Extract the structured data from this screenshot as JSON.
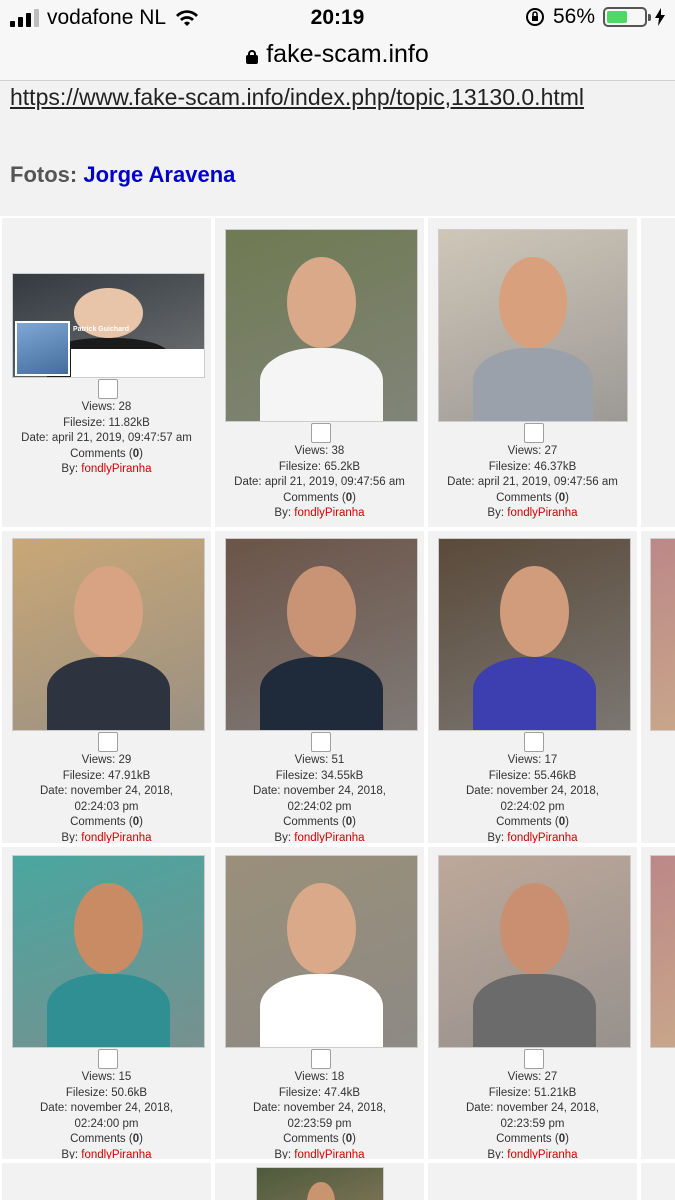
{
  "status_bar": {
    "carrier": "vodafone NL",
    "time": "20:19",
    "battery": "56%",
    "battery_level": 0.56
  },
  "url_bar": {
    "domain": "fake-scam.info"
  },
  "page": {
    "topic_url": "https://www.fake-scam.info/index.php/topic,13130.0.html",
    "fotos_label": "Fotos:",
    "person_name": "Jorge Aravena"
  },
  "overlay_name": "Patrick Guichard",
  "photos": [
    {
      "views": "Views: 28",
      "filesize": "Filesize: 11.82kB",
      "date": "Date: april 21, 2019, 09:47:57 am",
      "comments_label": "Comments (",
      "comments": "0",
      "comments_end": ")",
      "by": "By:",
      "user": "fondlyPiranha"
    },
    {
      "views": "Views: 38",
      "filesize": "Filesize: 65.2kB",
      "date": "Date: april 21, 2019, 09:47:56 am",
      "comments_label": "Comments (",
      "comments": "0",
      "comments_end": ")",
      "by": "By:",
      "user": "fondlyPiranha"
    },
    {
      "views": "Views: 27",
      "filesize": "Filesize: 46.37kB",
      "date": "Date: april 21, 2019, 09:47:56 am",
      "comments_label": "Comments (",
      "comments": "0",
      "comments_end": ")",
      "by": "By:",
      "user": "fondlyPiranha"
    },
    {
      "views": "Views: 29",
      "filesize": "Filesize: 47.91kB",
      "date": "Date: november 24, 2018,",
      "date2": "02:24:03 pm",
      "comments_label": "Comments (",
      "comments": "0",
      "comments_end": ")",
      "by": "By:",
      "user": "fondlyPiranha"
    },
    {
      "views": "Views: 51",
      "filesize": "Filesize: 34.55kB",
      "date": "Date: november 24, 2018,",
      "date2": "02:24:02 pm",
      "comments_label": "Comments (",
      "comments": "0",
      "comments_end": ")",
      "by": "By:",
      "user": "fondlyPiranha"
    },
    {
      "views": "Views: 17",
      "filesize": "Filesize: 55.46kB",
      "date": "Date: november 24, 2018,",
      "date2": "02:24:02 pm",
      "comments_label": "Comments (",
      "comments": "0",
      "comments_end": ")",
      "by": "By:",
      "user": "fondlyPiranha"
    },
    {
      "views": "Views: 15",
      "filesize": "Filesize: 50.6kB",
      "date": "Date: november 24, 2018,",
      "date2": "02:24:00 pm",
      "comments_label": "Comments (",
      "comments": "0",
      "comments_end": ")",
      "by": "By:",
      "user": "fondlyPiranha"
    },
    {
      "views": "Views: 18",
      "filesize": "Filesize: 47.4kB",
      "date": "Date: november 24, 2018,",
      "date2": "02:23:59 pm",
      "comments_label": "Comments (",
      "comments": "0",
      "comments_end": ")",
      "by": "By:",
      "user": "fondlyPiranha"
    },
    {
      "views": "Views: 27",
      "filesize": "Filesize: 51.21kB",
      "date": "Date: november 24, 2018,",
      "date2": "02:23:59 pm",
      "comments_label": "Comments (",
      "comments": "0",
      "comments_end": ")",
      "by": "By:",
      "user": "fondlyPiranha"
    }
  ]
}
